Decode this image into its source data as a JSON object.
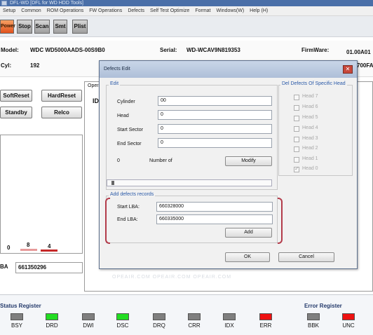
{
  "window": {
    "title": "DFL-WD   [DFL for WD HDD Tools]"
  },
  "menu": [
    "Setup",
    "Common",
    "ROM Operations",
    "FW Operations",
    "Defects",
    "Self Test Optimize",
    "Format",
    "Windows(W)",
    "Help (H)"
  ],
  "toolbar": {
    "power": "Power",
    "stop": "Stop",
    "scan": "Scan",
    "smt": "Smt",
    "plist": "Plist"
  },
  "drive": {
    "model_label": "Model:",
    "model": "WDC WD5000AADS-00S9B0",
    "serial_label": "Serial:",
    "serial": "WD-WCAV9N819353",
    "firmware_label": "FirmWare:",
    "firmware": "01.00A01",
    "cyl_label": "Cyl:",
    "cyl": "192",
    "partial": "700FA"
  },
  "left_panel": {
    "softreset": "SoftReset",
    "hardreset": "HardReset",
    "standby": "Standby",
    "relco": "Relco",
    "bar_values": [
      "0",
      "8",
      "4"
    ],
    "lba_label": "BA",
    "lba_value": "661350296"
  },
  "back_panel": {
    "tab": "Opera",
    "col": "ID"
  },
  "dialog": {
    "title": "Defects Edit",
    "edit_group": "Edit",
    "cylinder_label": "Cylinder",
    "cylinder": "00",
    "head_label": "Head",
    "head": "0",
    "start_sector_label": "Start Sector",
    "start_sector": "0",
    "end_sector_label": "End Sector",
    "end_sector": "0",
    "count": "0",
    "number_of_label": "Number of",
    "modify": "Modify",
    "add_group": "Add defects records",
    "start_lba_label": "Start LBA:",
    "start_lba": "660328000",
    "end_lba_label": "End LBA:",
    "end_lba": "660335000",
    "add": "Add",
    "ok": "OK",
    "cancel": "Cancel",
    "heads_group": "Del Defects Of Specific Head",
    "heads": [
      {
        "label": "Head 7",
        "checked": false
      },
      {
        "label": "Head 6",
        "checked": false
      },
      {
        "label": "Head 5",
        "checked": false
      },
      {
        "label": "Head 4",
        "checked": false
      },
      {
        "label": "Head 3",
        "checked": false
      },
      {
        "label": "Head 2",
        "checked": false
      },
      {
        "label": "Head 1",
        "checked": false
      },
      {
        "label": "Head 0",
        "checked": true
      }
    ]
  },
  "status_register": {
    "title": "Status Register",
    "leds": [
      {
        "label": "BSY",
        "color": "#7f7f7f"
      },
      {
        "label": "DRD",
        "color": "#22dd22"
      },
      {
        "label": "DWI",
        "color": "#7f7f7f"
      },
      {
        "label": "DSC",
        "color": "#22dd22"
      },
      {
        "label": "DRQ",
        "color": "#7f7f7f"
      },
      {
        "label": "CRR",
        "color": "#7f7f7f"
      },
      {
        "label": "IDX",
        "color": "#7f7f7f"
      },
      {
        "label": "ERR",
        "color": "#ee1111"
      }
    ]
  },
  "error_register": {
    "title": "Error Register",
    "leds": [
      {
        "label": "BBK",
        "color": "#7f7f7f"
      },
      {
        "label": "UNC",
        "color": "#ee1111"
      }
    ]
  }
}
